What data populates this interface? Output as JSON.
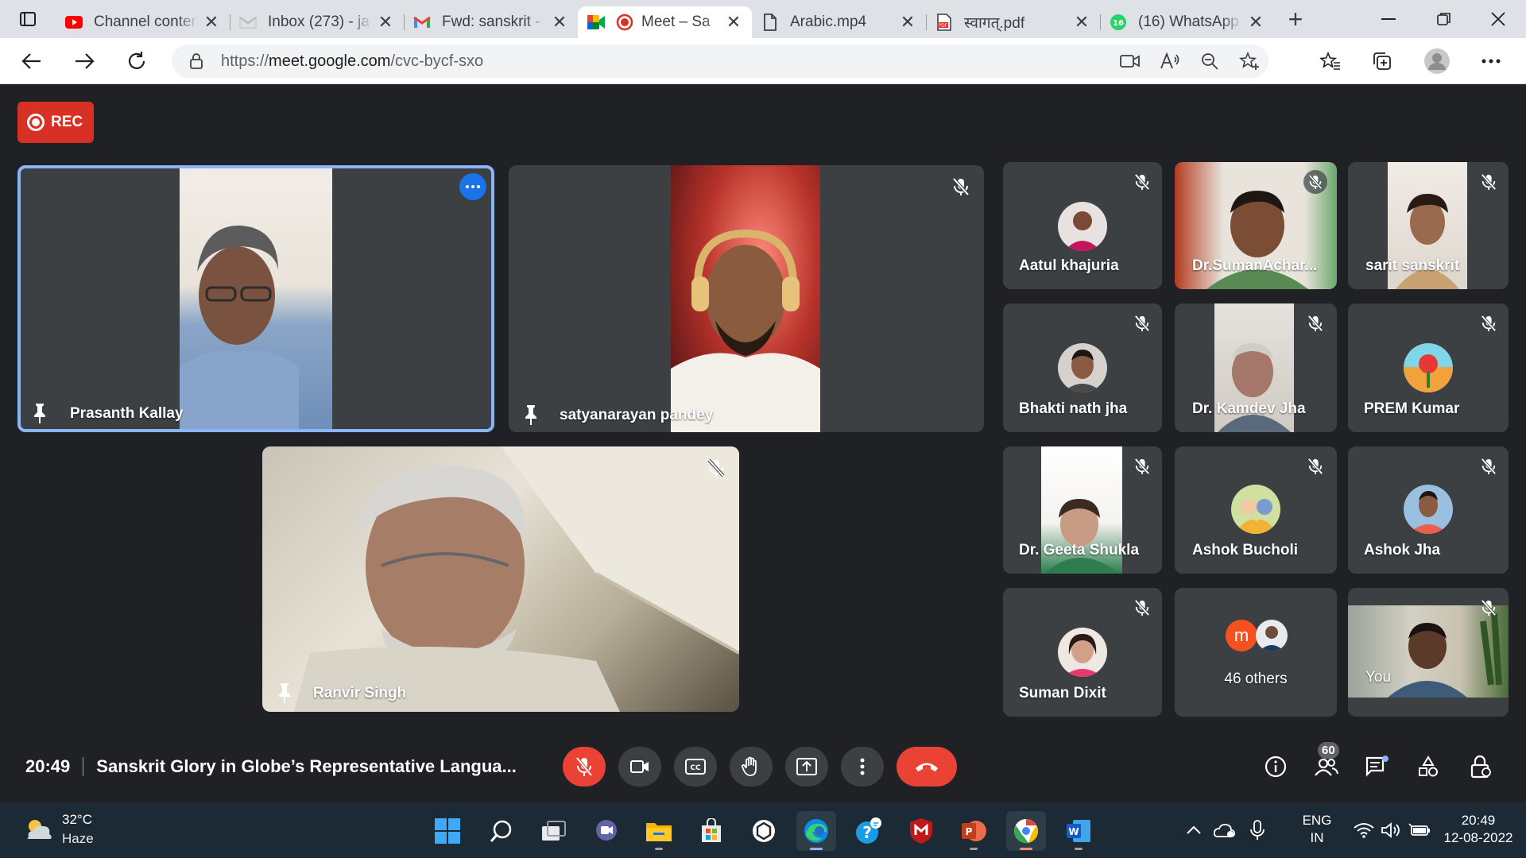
{
  "browser": {
    "tabs": [
      {
        "label": "Channel content",
        "icon": "youtube-icon"
      },
      {
        "label": "Inbox (273) - ja",
        "icon": "gmail-icon"
      },
      {
        "label": "Fwd: sanskrit -",
        "icon": "gmail-icon"
      },
      {
        "label": "Meet – Sa",
        "icon": "meet-icon",
        "active": true
      },
      {
        "label": "Arabic.mp4",
        "icon": "file-icon"
      },
      {
        "label": "स्वागत्.pdf",
        "icon": "pdf-icon"
      },
      {
        "label": "(16) WhatsApp",
        "icon": "whatsapp-icon",
        "badge": "16"
      }
    ],
    "url_prefix": "https://",
    "url_host": "meet.google.com",
    "url_path": "/cvc-bycf-sxo"
  },
  "meet": {
    "rec_label": "REC",
    "main_tiles": [
      {
        "name": "Prasanth Kallay"
      },
      {
        "name": "satyanarayan pandey"
      },
      {
        "name": "Ranvir Singh"
      }
    ],
    "grid_tiles": [
      {
        "name": "Aatul khajuria"
      },
      {
        "name": "Dr.SumanAchar..."
      },
      {
        "name": "sarit sanskrit"
      },
      {
        "name": "Bhakti nath jha"
      },
      {
        "name": "Dr. Kamdev Jha"
      },
      {
        "name": "PREM Kumar"
      },
      {
        "name": "Dr. Geeta Shukla"
      },
      {
        "name": "Ashok Bucholi"
      },
      {
        "name": "Ashok Jha"
      },
      {
        "name": "Suman Dixit"
      },
      {
        "name": "46 others",
        "avatar_letter": "m"
      },
      {
        "name": "You"
      }
    ],
    "time": "20:49",
    "meeting_title": "Sanskrit Glory in Globe’s Representative Langua...",
    "participant_count": "60"
  },
  "taskbar": {
    "temperature": "32°C",
    "condition": "Haze",
    "lang_top": "ENG",
    "lang_bottom": "IN",
    "clock_time": "20:49",
    "clock_date": "12-08-2022"
  },
  "colors": {
    "meet_bg": "#202124",
    "tile_bg": "#3c4043",
    "active_outline": "#8ab4f8",
    "red": "#ea4335"
  }
}
